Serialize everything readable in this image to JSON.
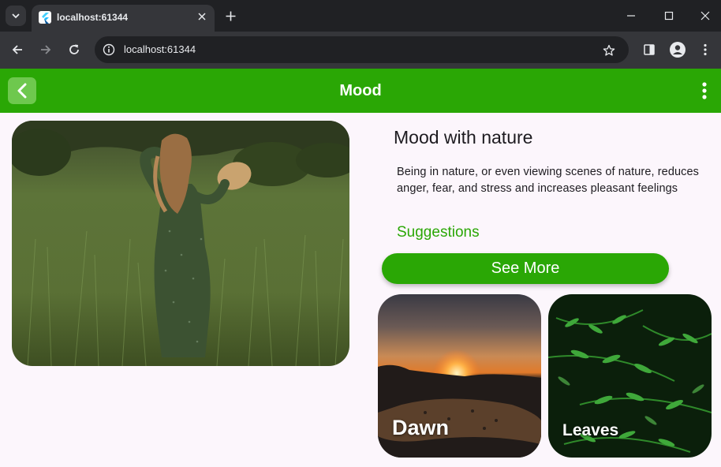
{
  "browser": {
    "tab_title": "localhost:61344",
    "url": "localhost:61344",
    "icons": {
      "tab_search": "chevron-down-icon",
      "favicon": "flutter-icon",
      "tab_close": "close-icon",
      "new_tab": "plus-icon",
      "minimize": "minimize-icon",
      "maximize": "maximize-icon",
      "close_window": "close-icon",
      "back": "arrow-left-icon",
      "forward": "arrow-right-icon",
      "reload": "reload-icon",
      "site_info": "info-icon",
      "bookmark": "star-icon",
      "side_panel": "side-panel-icon",
      "profile": "profile-icon",
      "menu": "kebab-menu-icon"
    }
  },
  "appbar": {
    "title": "Mood",
    "back_icon": "chevron-left-icon",
    "menu_icon": "kebab-menu-icon"
  },
  "content": {
    "title": "Mood with nature",
    "description": "Being in nature, or even viewing scenes of nature, reduces anger, fear, and stress and increases pleasant feelings",
    "suggestions_label": "Suggestions",
    "see_more_label": "See More",
    "cards": [
      {
        "label": "Dawn"
      },
      {
        "label": "Leaves"
      }
    ]
  },
  "colors": {
    "accent": "#2aa705",
    "background": "#fcf6fc",
    "chrome_dark": "#202124",
    "chrome_mid": "#35363a"
  }
}
